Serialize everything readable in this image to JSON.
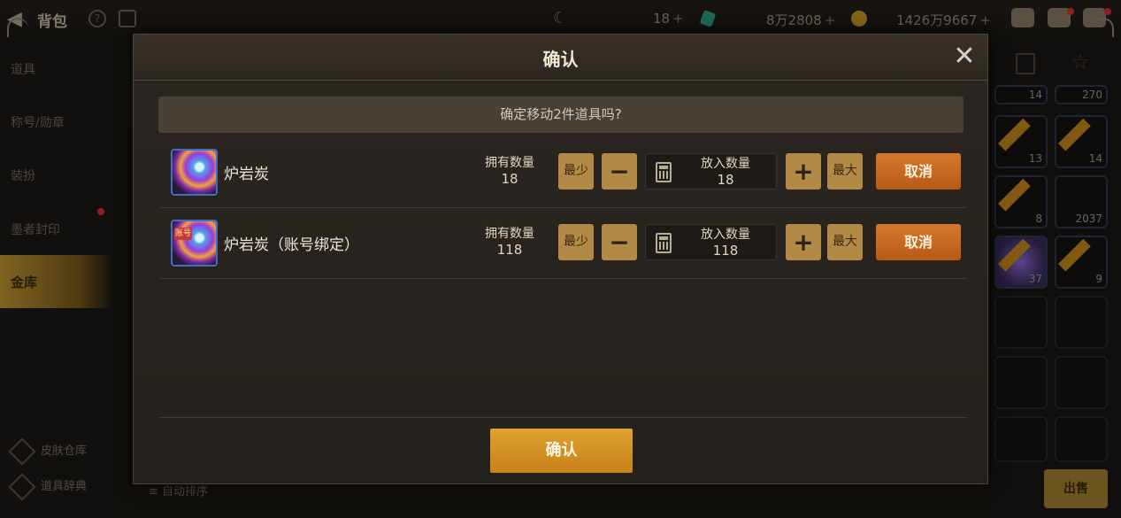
{
  "background": {
    "title": "背包",
    "currencies": {
      "gems": "18",
      "crystals": "8万2808",
      "gold": "1426万9667"
    },
    "sidebar": [
      "道具",
      "称号/勋章",
      "装扮",
      "墨者封印",
      "金库"
    ],
    "bottom_links": [
      "皮肤仓库",
      "道具辞典"
    ],
    "sort_label": "自动排序",
    "sell_label": "出售",
    "slot_quantities": [
      "14",
      "270",
      "13",
      "14",
      "8",
      "2037",
      "37",
      "9"
    ]
  },
  "modal": {
    "title": "确认",
    "message": "确定移动2件道具吗?",
    "items": [
      {
        "name": "炉岩炭",
        "owned_label": "拥有数量",
        "owned": "18",
        "min_label": "最少",
        "max_label": "最大",
        "qty_label": "放入数量",
        "qty": "18",
        "cancel_label": "取消",
        "tag": ""
      },
      {
        "name": "炉岩炭（账号绑定）",
        "owned_label": "拥有数量",
        "owned": "118",
        "min_label": "最少",
        "max_label": "最大",
        "qty_label": "放入数量",
        "qty": "118",
        "cancel_label": "取消",
        "tag": "账号"
      }
    ],
    "confirm_label": "确认",
    "minus_symbol": "−",
    "plus_symbol": "+",
    "close_symbol": "✕"
  },
  "colors": {
    "accent_gold": "#c7821a",
    "cancel_orange": "#d6782a",
    "stepper_tan": "#b38a45"
  }
}
